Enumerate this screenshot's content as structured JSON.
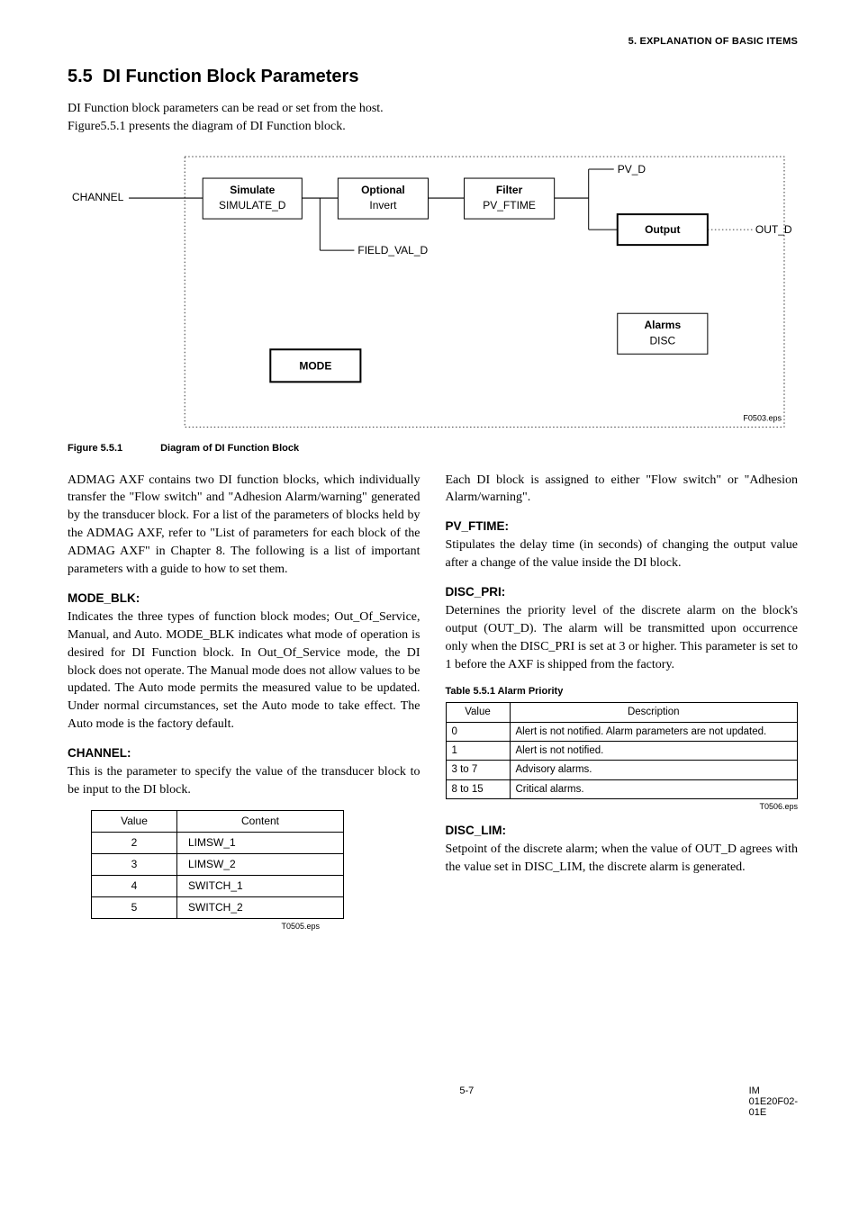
{
  "header": {
    "chapter": "5.  EXPLANATION OF BASIC ITEMS"
  },
  "section": {
    "number": "5.5",
    "title": "DI Function Block Parameters"
  },
  "intro": "DI Function block parameters can be read or set from the host. Figure5.5.1 presents the diagram of DI Function block.",
  "diagram": {
    "channel": "CHANNEL",
    "simulate_title": "Simulate",
    "simulate_sub": "SIMULATE_D",
    "optional_title": "Optional",
    "optional_sub": "Invert",
    "filter_title": "Filter",
    "filter_sub": "PV_FTIME",
    "field_val": "FIELD_VAL_D",
    "pv_d": "PV_D",
    "output": "Output",
    "out_d": "OUT_D",
    "alarms_title": "Alarms",
    "alarms_sub": "DISC",
    "mode": "MODE",
    "fnum": "F0503.eps"
  },
  "figcaption": {
    "num": "Figure 5.5.1",
    "title": "Diagram of DI Function Block"
  },
  "left": {
    "p1": "ADMAG AXF contains two DI function blocks, which individually transfer the \"Flow switch\" and \"Adhesion Alarm/warning\" generated by the transducer block. For a list of the parameters of blocks held by the ADMAG AXF, refer to \"List of parameters for each block of the ADMAG AXF\" in Chapter 8. The following is a list of important parameters with a guide to how to set them.",
    "mode_h": "MODE_BLK:",
    "mode_p": "Indicates the three types of function block modes; Out_Of_Service, Manual, and Auto. MODE_BLK indicates what mode of operation is desired for DI Function block. In Out_Of_Service mode, the DI block does not operate. The Manual mode does not allow values to be updated. The Auto mode permits the measured value to be updated. Under normal circumstances, set the Auto mode to take effect. The Auto mode is the factory default.",
    "channel_h": "CHANNEL:",
    "channel_p": "This is the parameter to specify the value of the transducer block to be input to the DI block.",
    "table": {
      "h1": "Value",
      "h2": "Content",
      "rows": [
        {
          "v": "2",
          "c": "LIMSW_1"
        },
        {
          "v": "3",
          "c": "LIMSW_2"
        },
        {
          "v": "4",
          "c": "SWITCH_1"
        },
        {
          "v": "5",
          "c": "SWITCH_2"
        }
      ],
      "note": "T0505.eps"
    }
  },
  "right": {
    "p1": "Each DI block is assigned to either \"Flow switch\" or \"Adhesion Alarm/warning\".",
    "pvftime_h": "PV_FTIME:",
    "pvftime_p": "Stipulates the delay time (in seconds) of changing the output value after a change of the value inside the DI block.",
    "discpri_h": "DISC_PRI:",
    "discpri_p": "Deternines the priority level of the discrete alarm on the block's output (OUT_D). The alarm will be transmitted upon occurrence only when the DISC_PRI is set at 3 or higher. This parameter is set to 1 before the AXF is shipped from the factory.",
    "tbl_caption": "Table 5.5.1 Alarm Priority",
    "priotable": {
      "h1": "Value",
      "h2": "Description",
      "rows": [
        {
          "v": "0",
          "d": "Alert is not notified. Alarm parameters are not updated."
        },
        {
          "v": "1",
          "d": "Alert is not notified."
        },
        {
          "v": "3 to 7",
          "d": "Advisory alarms."
        },
        {
          "v": "8 to 15",
          "d": "Critical alarms."
        }
      ],
      "note": "T0506.eps"
    },
    "disclim_h": "DISC_LIM:",
    "disclim_p": "Setpoint of the discrete alarm; when the value of OUT_D agrees with the value set in DISC_LIM, the discrete alarm is generated."
  },
  "footer": {
    "page": "5-7",
    "doc": "IM 01E20F02-01E"
  }
}
